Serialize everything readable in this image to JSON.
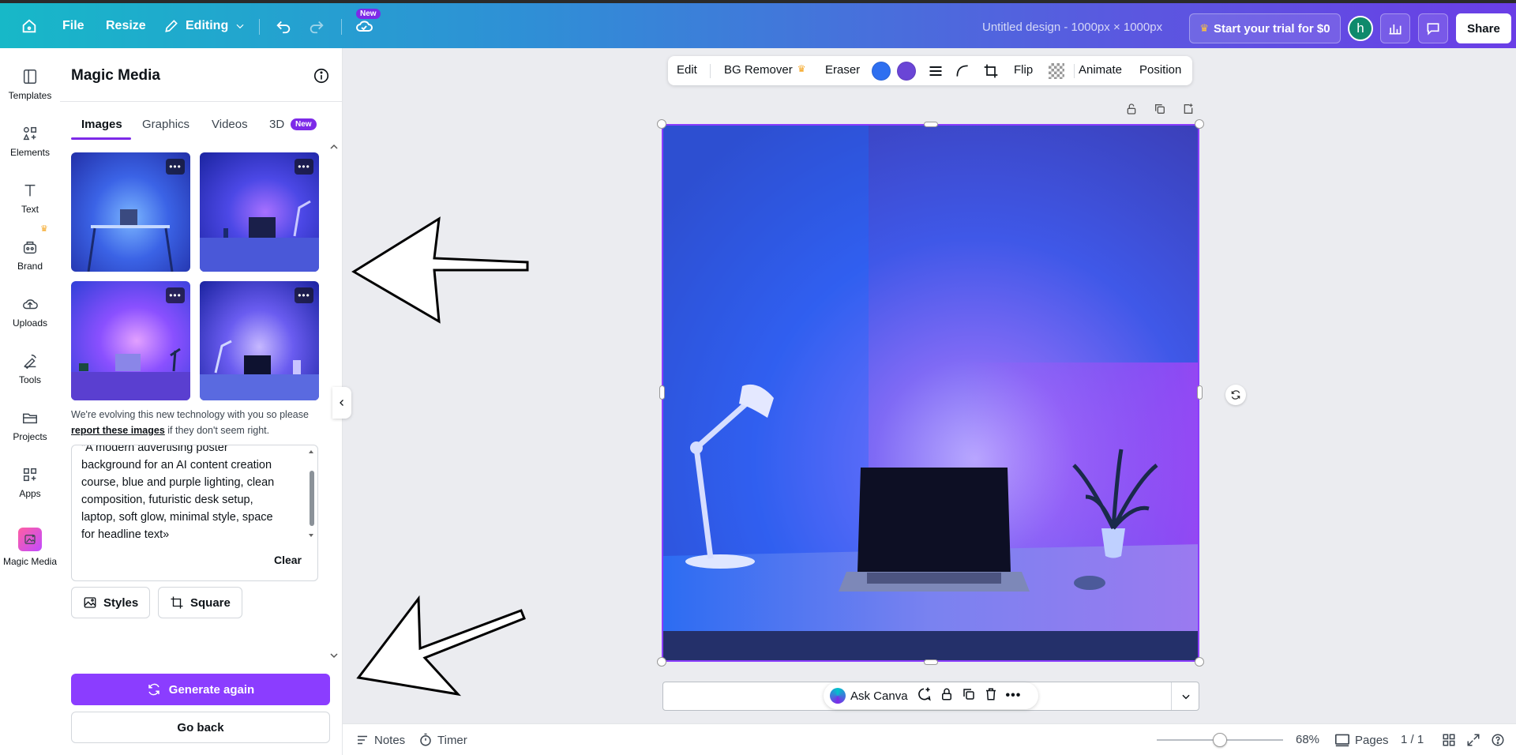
{
  "topbar": {
    "file": "File",
    "resize": "Resize",
    "editing": "Editing",
    "new_badge": "New",
    "title": "Untitled design - 1000px × 1000px",
    "trial": "Start your trial for $0",
    "avatar_initial": "h",
    "share": "Share"
  },
  "rail": [
    {
      "label": "Templates",
      "icon": "templates-icon"
    },
    {
      "label": "Elements",
      "icon": "elements-icon"
    },
    {
      "label": "Text",
      "icon": "text-icon"
    },
    {
      "label": "Brand",
      "icon": "brand-icon"
    },
    {
      "label": "Uploads",
      "icon": "uploads-icon"
    },
    {
      "label": "Tools",
      "icon": "tools-icon"
    },
    {
      "label": "Projects",
      "icon": "projects-icon"
    },
    {
      "label": "Apps",
      "icon": "apps-icon"
    },
    {
      "label": "Magic Media",
      "icon": "magic-media-icon"
    }
  ],
  "panel": {
    "title": "Magic Media",
    "tabs": [
      "Images",
      "Graphics",
      "Videos",
      "3D"
    ],
    "tab_badge": "New",
    "note_before": "We're evolving this new technology with you so please ",
    "note_link": "report these images",
    "note_after": " if they don't seem right.",
    "prompt_lines": [
      "\"A modern advertising poster",
      "background for an AI content creation",
      "course, blue and purple lighting, clean",
      "composition, futuristic desk setup,",
      "laptop, soft glow, minimal style, space",
      "for headline text»"
    ],
    "clear": "Clear",
    "styles": "Styles",
    "square": "Square",
    "generate": "Generate again",
    "back": "Go back"
  },
  "context_toolbar": {
    "edit": "Edit",
    "bg_remover": "BG Remover",
    "eraser": "Eraser",
    "flip": "Flip",
    "animate": "Animate",
    "position": "Position",
    "color1": "#2e6ff0",
    "color2": "#6a45d6"
  },
  "floating": {
    "ask": "Ask Canva"
  },
  "footer": {
    "notes": "Notes",
    "timer": "Timer",
    "zoom": "68%",
    "pages": "Pages",
    "page_count": "1 / 1"
  },
  "colors": {
    "accent": "#8b3dff",
    "brand_gradient_start": "#17b8c8",
    "brand_gradient_end": "#6a3ee6"
  }
}
